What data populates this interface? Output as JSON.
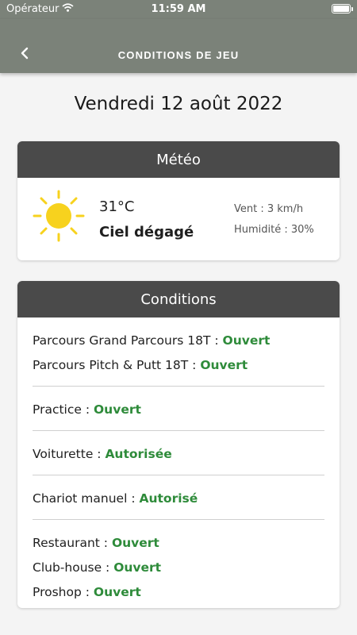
{
  "status_bar": {
    "carrier": "Opérateur",
    "time": "11:59 AM"
  },
  "nav": {
    "title": "CONDITIONS DE JEU"
  },
  "date": "Vendredi 12 août 2022",
  "meteo": {
    "header": "Météo",
    "icon": "sun-icon",
    "temperature": "31°C",
    "sky": "Ciel dégagé",
    "wind": "Vent : 3 km/h",
    "humidity": "Humidité : 30%"
  },
  "conditions": {
    "header": "Conditions",
    "groups": [
      [
        {
          "label": "Parcours Grand Parcours 18T : ",
          "value": "Ouvert"
        },
        {
          "label": "Parcours Pitch & Putt 18T : ",
          "value": "Ouvert"
        }
      ],
      [
        {
          "label": "Practice  : ",
          "value": "Ouvert"
        }
      ],
      [
        {
          "label": "Voiturette  : ",
          "value": "Autorisée"
        }
      ],
      [
        {
          "label": "Chariot manuel  : ",
          "value": "Autorisé"
        }
      ],
      [
        {
          "label": "Restaurant  : ",
          "value": "Ouvert"
        },
        {
          "label": "Club-house  : ",
          "value": "Ouvert"
        },
        {
          "label": "Proshop  : ",
          "value": "Ouvert"
        }
      ]
    ]
  },
  "colors": {
    "nav": "#7b8279",
    "header": "#4a4a4a",
    "status_green": "#2e8b3a",
    "sun": "#f7d21e"
  }
}
